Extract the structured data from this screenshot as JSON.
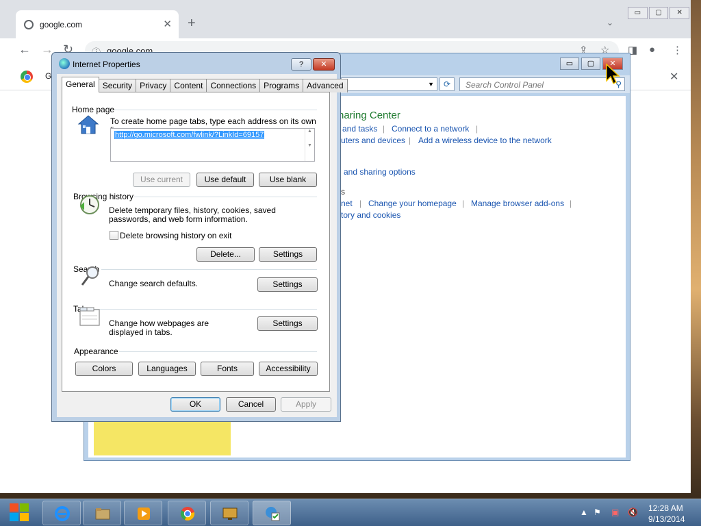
{
  "browser": {
    "tab_title": "google.com",
    "tab_close": "✕",
    "new_tab": "+",
    "tab_search": "⌄",
    "window_controls": [
      "▭",
      "▢",
      "✕"
    ],
    "address": "google.com",
    "infobar_text": "G",
    "infobar_close": "✕"
  },
  "control_panel": {
    "search_placeholder": "Search Control Panel",
    "heading": "haring Center",
    "links": {
      "view_tasks": "and tasks",
      "connect_network": "Connect to a network",
      "computers_devices": "uters and devices",
      "add_wireless": "Add a wireless device to the network",
      "sharing_options": "and sharing options",
      "section_s": "s",
      "net": "net",
      "change_homepage": "Change your homepage",
      "manage_addons": "Manage browser add-ons",
      "history_cookies": "tory and cookies"
    }
  },
  "dialog": {
    "title": "Internet Properties",
    "help": "?",
    "close": "✕",
    "tabs": [
      "General",
      "Security",
      "Privacy",
      "Content",
      "Connections",
      "Programs",
      "Advanced"
    ],
    "home_page": {
      "label": "Home page",
      "instruction": "To create home page tabs, type each address on its own line.",
      "url": "http://go.microsoft.com/fwlink/?LinkId=69157",
      "use_current": "Use current",
      "use_default": "Use default",
      "use_blank": "Use blank"
    },
    "browsing_history": {
      "label": "Browsing history",
      "description": "Delete temporary files, history, cookies, saved passwords, and web form information.",
      "checkbox_label": "Delete browsing history on exit",
      "checked": false,
      "delete": "Delete...",
      "settings": "Settings"
    },
    "search": {
      "label": "Search",
      "description": "Change search defaults.",
      "settings": "Settings"
    },
    "tabs_section": {
      "label": "Tabs",
      "description": "Change how webpages are displayed in tabs.",
      "settings": "Settings"
    },
    "appearance": {
      "label": "Appearance",
      "colors": "Colors",
      "languages": "Languages",
      "fonts": "Fonts",
      "accessibility": "Accessibility"
    },
    "ok": "OK",
    "cancel": "Cancel",
    "apply": "Apply"
  },
  "taskbar": {
    "time": "12:28 AM",
    "date": "9/13/2014"
  }
}
